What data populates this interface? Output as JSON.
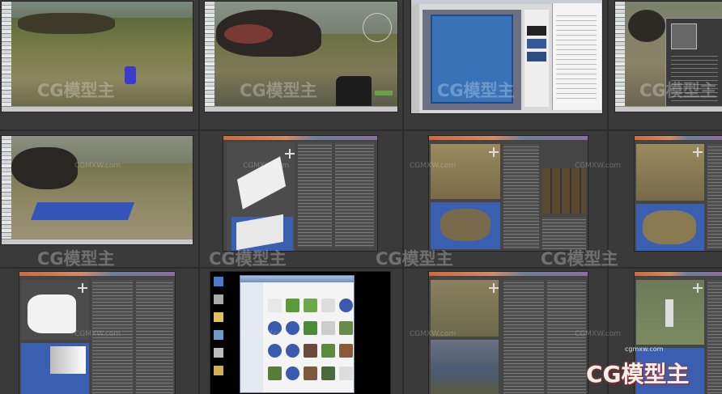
{
  "watermark": {
    "brand": "CG模型主",
    "url": "CGMXW.com",
    "logo_text": "CG模型主",
    "logo_url": "cgmxw.com"
  },
  "tiles": [
    {
      "row": 1,
      "col": 1,
      "content": "game-viewport-terrain-with-blue-object"
    },
    {
      "row": 1,
      "col": 2,
      "content": "game-viewport-rocks-with-weapon"
    },
    {
      "row": 1,
      "col": 3,
      "content": "texture-editor-blue-texture"
    },
    {
      "row": 1,
      "col": 4,
      "content": "game-viewport-with-dark-dialog"
    },
    {
      "row": 2,
      "col": 1,
      "content": "game-viewport-blue-plane"
    },
    {
      "row": 2,
      "col": 2,
      "content": "3d-editor-white-planes"
    },
    {
      "row": 2,
      "col": 3,
      "content": "3d-editor-terrain-texture-palette"
    },
    {
      "row": 2,
      "col": 4,
      "content": "3d-editor-terrain-island"
    },
    {
      "row": 3,
      "col": 1,
      "content": "3d-editor-white-model"
    },
    {
      "row": 3,
      "col": 2,
      "content": "file-browser-texture-thumbnails"
    },
    {
      "row": 3,
      "col": 3,
      "content": "3d-editor-terrain-views"
    },
    {
      "row": 3,
      "col": 4,
      "content": "3d-editor-pillar-on-terrain"
    }
  ],
  "colors": {
    "background": "#3a3a3a",
    "grid_line": "#2b2b2b",
    "viewport_blue": "#3a5fb0",
    "terrain_tan": "#8a7a4e",
    "editor_dark": "#454545"
  }
}
